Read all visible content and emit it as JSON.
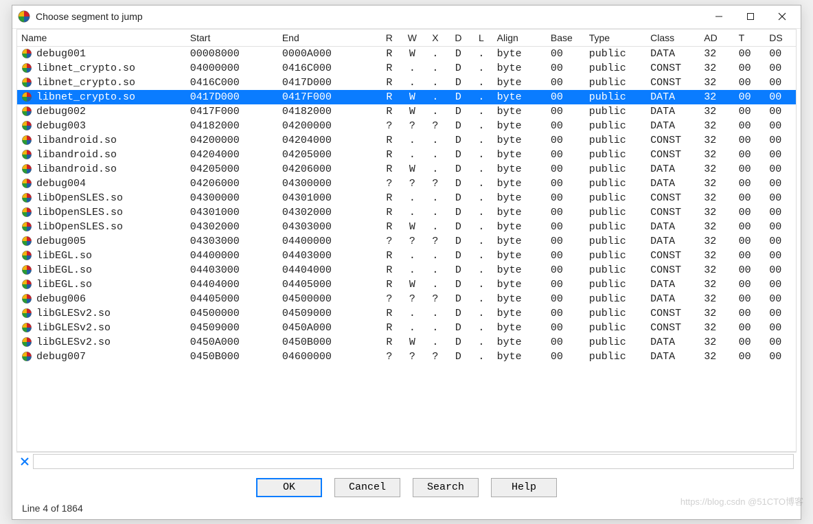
{
  "window": {
    "title": "Choose segment to jump"
  },
  "columns": {
    "name": "Name",
    "start": "Start",
    "end": "End",
    "r": "R",
    "w": "W",
    "x": "X",
    "d": "D",
    "l": "L",
    "align": "Align",
    "base": "Base",
    "type": "Type",
    "class": "Class",
    "ad": "AD",
    "t": "T",
    "ds": "DS"
  },
  "rows": [
    {
      "name": "debug001",
      "start": "00008000",
      "end": "0000A000",
      "r": "R",
      "w": "W",
      "x": ".",
      "d": "D",
      "l": ".",
      "align": "byte",
      "base": "00",
      "type": "public",
      "class": "DATA",
      "ad": "32",
      "t": "00",
      "ds": "00",
      "selected": false
    },
    {
      "name": "libnet_crypto.so",
      "start": "04000000",
      "end": "0416C000",
      "r": "R",
      "w": ".",
      "x": ".",
      "d": "D",
      "l": ".",
      "align": "byte",
      "base": "00",
      "type": "public",
      "class": "CONST",
      "ad": "32",
      "t": "00",
      "ds": "00",
      "selected": false
    },
    {
      "name": "libnet_crypto.so",
      "start": "0416C000",
      "end": "0417D000",
      "r": "R",
      "w": ".",
      "x": ".",
      "d": "D",
      "l": ".",
      "align": "byte",
      "base": "00",
      "type": "public",
      "class": "CONST",
      "ad": "32",
      "t": "00",
      "ds": "00",
      "selected": false
    },
    {
      "name": "libnet_crypto.so",
      "start": "0417D000",
      "end": "0417F000",
      "r": "R",
      "w": "W",
      "x": ".",
      "d": "D",
      "l": ".",
      "align": "byte",
      "base": "00",
      "type": "public",
      "class": "DATA",
      "ad": "32",
      "t": "00",
      "ds": "00",
      "selected": true
    },
    {
      "name": "debug002",
      "start": "0417F000",
      "end": "04182000",
      "r": "R",
      "w": "W",
      "x": ".",
      "d": "D",
      "l": ".",
      "align": "byte",
      "base": "00",
      "type": "public",
      "class": "DATA",
      "ad": "32",
      "t": "00",
      "ds": "00",
      "selected": false
    },
    {
      "name": "debug003",
      "start": "04182000",
      "end": "04200000",
      "r": "?",
      "w": "?",
      "x": "?",
      "d": "D",
      "l": ".",
      "align": "byte",
      "base": "00",
      "type": "public",
      "class": "DATA",
      "ad": "32",
      "t": "00",
      "ds": "00",
      "selected": false
    },
    {
      "name": "libandroid.so",
      "start": "04200000",
      "end": "04204000",
      "r": "R",
      "w": ".",
      "x": ".",
      "d": "D",
      "l": ".",
      "align": "byte",
      "base": "00",
      "type": "public",
      "class": "CONST",
      "ad": "32",
      "t": "00",
      "ds": "00",
      "selected": false
    },
    {
      "name": "libandroid.so",
      "start": "04204000",
      "end": "04205000",
      "r": "R",
      "w": ".",
      "x": ".",
      "d": "D",
      "l": ".",
      "align": "byte",
      "base": "00",
      "type": "public",
      "class": "CONST",
      "ad": "32",
      "t": "00",
      "ds": "00",
      "selected": false
    },
    {
      "name": "libandroid.so",
      "start": "04205000",
      "end": "04206000",
      "r": "R",
      "w": "W",
      "x": ".",
      "d": "D",
      "l": ".",
      "align": "byte",
      "base": "00",
      "type": "public",
      "class": "DATA",
      "ad": "32",
      "t": "00",
      "ds": "00",
      "selected": false
    },
    {
      "name": "debug004",
      "start": "04206000",
      "end": "04300000",
      "r": "?",
      "w": "?",
      "x": "?",
      "d": "D",
      "l": ".",
      "align": "byte",
      "base": "00",
      "type": "public",
      "class": "DATA",
      "ad": "32",
      "t": "00",
      "ds": "00",
      "selected": false
    },
    {
      "name": "libOpenSLES.so",
      "start": "04300000",
      "end": "04301000",
      "r": "R",
      "w": ".",
      "x": ".",
      "d": "D",
      "l": ".",
      "align": "byte",
      "base": "00",
      "type": "public",
      "class": "CONST",
      "ad": "32",
      "t": "00",
      "ds": "00",
      "selected": false
    },
    {
      "name": "libOpenSLES.so",
      "start": "04301000",
      "end": "04302000",
      "r": "R",
      "w": ".",
      "x": ".",
      "d": "D",
      "l": ".",
      "align": "byte",
      "base": "00",
      "type": "public",
      "class": "CONST",
      "ad": "32",
      "t": "00",
      "ds": "00",
      "selected": false
    },
    {
      "name": "libOpenSLES.so",
      "start": "04302000",
      "end": "04303000",
      "r": "R",
      "w": "W",
      "x": ".",
      "d": "D",
      "l": ".",
      "align": "byte",
      "base": "00",
      "type": "public",
      "class": "DATA",
      "ad": "32",
      "t": "00",
      "ds": "00",
      "selected": false
    },
    {
      "name": "debug005",
      "start": "04303000",
      "end": "04400000",
      "r": "?",
      "w": "?",
      "x": "?",
      "d": "D",
      "l": ".",
      "align": "byte",
      "base": "00",
      "type": "public",
      "class": "DATA",
      "ad": "32",
      "t": "00",
      "ds": "00",
      "selected": false
    },
    {
      "name": "libEGL.so",
      "start": "04400000",
      "end": "04403000",
      "r": "R",
      "w": ".",
      "x": ".",
      "d": "D",
      "l": ".",
      "align": "byte",
      "base": "00",
      "type": "public",
      "class": "CONST",
      "ad": "32",
      "t": "00",
      "ds": "00",
      "selected": false
    },
    {
      "name": "libEGL.so",
      "start": "04403000",
      "end": "04404000",
      "r": "R",
      "w": ".",
      "x": ".",
      "d": "D",
      "l": ".",
      "align": "byte",
      "base": "00",
      "type": "public",
      "class": "CONST",
      "ad": "32",
      "t": "00",
      "ds": "00",
      "selected": false
    },
    {
      "name": "libEGL.so",
      "start": "04404000",
      "end": "04405000",
      "r": "R",
      "w": "W",
      "x": ".",
      "d": "D",
      "l": ".",
      "align": "byte",
      "base": "00",
      "type": "public",
      "class": "DATA",
      "ad": "32",
      "t": "00",
      "ds": "00",
      "selected": false
    },
    {
      "name": "debug006",
      "start": "04405000",
      "end": "04500000",
      "r": "?",
      "w": "?",
      "x": "?",
      "d": "D",
      "l": ".",
      "align": "byte",
      "base": "00",
      "type": "public",
      "class": "DATA",
      "ad": "32",
      "t": "00",
      "ds": "00",
      "selected": false
    },
    {
      "name": "libGLESv2.so",
      "start": "04500000",
      "end": "04509000",
      "r": "R",
      "w": ".",
      "x": ".",
      "d": "D",
      "l": ".",
      "align": "byte",
      "base": "00",
      "type": "public",
      "class": "CONST",
      "ad": "32",
      "t": "00",
      "ds": "00",
      "selected": false
    },
    {
      "name": "libGLESv2.so",
      "start": "04509000",
      "end": "0450A000",
      "r": "R",
      "w": ".",
      "x": ".",
      "d": "D",
      "l": ".",
      "align": "byte",
      "base": "00",
      "type": "public",
      "class": "CONST",
      "ad": "32",
      "t": "00",
      "ds": "00",
      "selected": false
    },
    {
      "name": "libGLESv2.so",
      "start": "0450A000",
      "end": "0450B000",
      "r": "R",
      "w": "W",
      "x": ".",
      "d": "D",
      "l": ".",
      "align": "byte",
      "base": "00",
      "type": "public",
      "class": "DATA",
      "ad": "32",
      "t": "00",
      "ds": "00",
      "selected": false
    },
    {
      "name": "debug007",
      "start": "0450B000",
      "end": "04600000",
      "r": "?",
      "w": "?",
      "x": "?",
      "d": "D",
      "l": ".",
      "align": "byte",
      "base": "00",
      "type": "public",
      "class": "DATA",
      "ad": "32",
      "t": "00",
      "ds": "00",
      "selected": false
    }
  ],
  "filter": {
    "value": ""
  },
  "buttons": {
    "ok": "OK",
    "cancel": "Cancel",
    "search": "Search",
    "help": "Help"
  },
  "status": "Line 4 of 1864",
  "watermark": "https://blog.csdn  @51CTO博客"
}
